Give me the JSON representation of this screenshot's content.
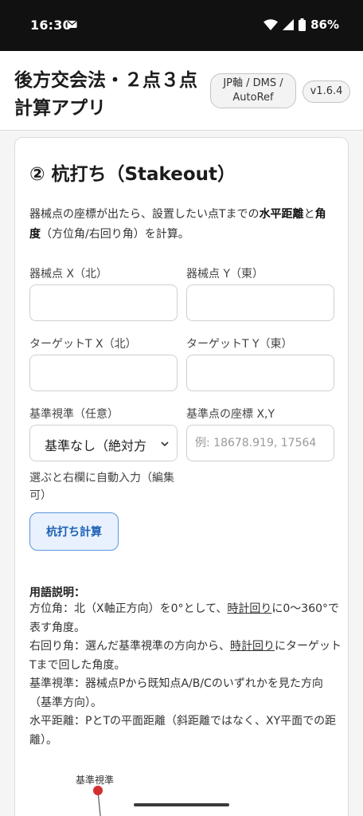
{
  "status_bar": {
    "time": "16:30",
    "battery_percent": "86%",
    "icons": [
      "mail-icon",
      "wifi-icon",
      "signal-icon",
      "battery-icon"
    ]
  },
  "header": {
    "title": "後方交会法・２点３点計算アプリ",
    "axis_chip": "JP軸 / DMS / AutoRef",
    "version": "v1.6.4"
  },
  "stakeout": {
    "title": "② 杭打ち（Stakeout）",
    "desc_part1": "器械点の座標が出たら、設置したい点Tまでの",
    "desc_bold1": "水平距離",
    "desc_part2": "と",
    "desc_bold2": "角度",
    "desc_part3": "（方位角/右回り角）を計算。",
    "instrument_x_label": "器械点 X（北）",
    "instrument_y_label": "器械点 Y（東）",
    "target_x_label": "ターゲットT X（北）",
    "target_y_label": "ターゲットT Y（東）",
    "reference_label": "基準視準（任意）",
    "reference_selected": "基準なし（絶対方",
    "ref_coord_label": "基準点の座標 X,Y",
    "ref_coord_placeholder": "例: 18678.919, 17564",
    "helper_text": "選ぶと右欄に自動入力（編集可）",
    "calc_button": "杭打ち計算"
  },
  "glossary": {
    "heading": "用語説明：",
    "azimuth_a": "方位角：北（X軸正方向）を0°として、",
    "azimuth_u": "時計回り",
    "azimuth_b": "に0〜360°で表す角度。",
    "rightangle_a": "右回り角：選んだ基準視準の方向から、",
    "rightangle_u": "時計回り",
    "rightangle_b": "にターゲットTまで回した角度。",
    "reference": "基準視準：器械点Pから既知点A/B/Cのいずれかを見た方向（基準方向）。",
    "horizontal": "水平距離：PとTの平面距離（斜距離ではなく、XY平面での距離）。"
  },
  "diagram": {
    "label": "基準視準"
  },
  "colors": {
    "accent": "#1d5fb4",
    "button_bg": "#e8f1fd",
    "diagram_point": "#d32f2f"
  }
}
